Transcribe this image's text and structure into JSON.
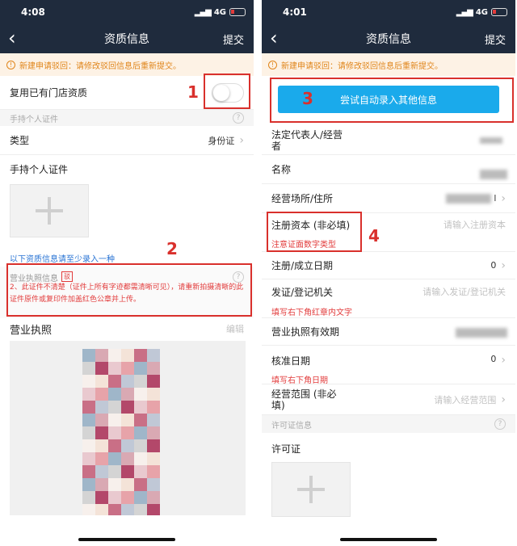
{
  "left": {
    "status": {
      "time": "4:08",
      "network": "4G"
    },
    "nav": {
      "title": "资质信息",
      "submit": "提交"
    },
    "notice": "新建申请驳回：请修改驳回信息后重新提交。",
    "reuse_label": "复用已有门店资质",
    "section_personal": "手持个人证件",
    "type_label": "类型",
    "type_value": "身份证",
    "handheld_label": "手持个人证件",
    "min_one_hint": "以下资质信息请至少录入一种",
    "license_section": "营业执照信息",
    "license_tag": "驳",
    "license_error": "2、此证件不清楚（证件上所有字迹都需清晰可见），请重新拍摄清晰的此证件原件或复印件加盖红色公章并上传。",
    "license_label": "营业执照",
    "edit_label": "编辑",
    "markers": [
      "1",
      "2"
    ]
  },
  "right": {
    "status": {
      "time": "4:01",
      "network": "4G"
    },
    "nav": {
      "title": "资质信息",
      "submit": "提交"
    },
    "notice": "新建申请驳回：请修改驳回信息后重新提交。",
    "auto_fill_button": "尝试自动录入其他信息",
    "fields": [
      {
        "label": "法定代表人/经营者"
      },
      {
        "label": "名称"
      },
      {
        "label": "经营场所/住所",
        "value": "l"
      },
      {
        "label": "注册资本 (非必填)",
        "placeholder": "请输入注册资本"
      },
      {
        "label": "注册/成立日期",
        "value": "0"
      },
      {
        "label": "发证/登记机关",
        "placeholder": "请输入发证/登记机关"
      },
      {
        "label": "营业执照有效期"
      },
      {
        "label": "核准日期",
        "value": "0"
      },
      {
        "label": "经营范围 (非必填)",
        "placeholder": "请输入经营范围"
      }
    ],
    "hint_capital": "注意证面数字类型",
    "hint_authority": "填写右下角红章内文字",
    "hint_date": "填写右下角日期",
    "section_permit": "许可证信息",
    "permit_label": "许可证",
    "markers": [
      "3",
      "4"
    ]
  },
  "colors": {
    "navbar": "#1f2b3d",
    "accent_blue": "#1aaaeb",
    "error_red": "#e23b3b",
    "marker_red": "#d9302c",
    "notice_bg": "#fdf2e5"
  },
  "icons": [
    "back-arrow-icon",
    "info-icon",
    "chevron-right-icon",
    "question-mark-icon",
    "plus-icon",
    "battery-icon",
    "signal-icon"
  ]
}
